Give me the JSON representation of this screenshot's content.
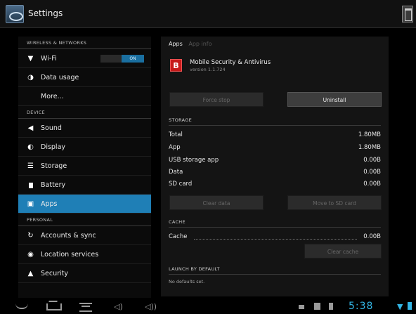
{
  "action_bar": {
    "title": "Settings"
  },
  "left_pane": {
    "sections": [
      {
        "header": "WIRELESS & NETWORKS",
        "items": [
          {
            "label": "Wi-Fi",
            "icon": "wifi-icon",
            "toggle": "ON"
          },
          {
            "label": "Data usage",
            "icon": "data-usage-icon"
          },
          {
            "label": "More..."
          }
        ]
      },
      {
        "header": "DEVICE",
        "items": [
          {
            "label": "Sound",
            "icon": "speaker-icon"
          },
          {
            "label": "Display",
            "icon": "display-icon"
          },
          {
            "label": "Storage",
            "icon": "storage-icon"
          },
          {
            "label": "Battery",
            "icon": "battery-icon"
          },
          {
            "label": "Apps",
            "icon": "apps-icon",
            "selected": true
          }
        ]
      },
      {
        "header": "PERSONAL",
        "items": [
          {
            "label": "Accounts & sync",
            "icon": "sync-icon"
          },
          {
            "label": "Location services",
            "icon": "location-icon"
          },
          {
            "label": "Security",
            "icon": "lock-icon"
          }
        ]
      }
    ]
  },
  "right_pane": {
    "breadcrumb": {
      "parent": "Apps",
      "current": "App info"
    },
    "app": {
      "name": "Mobile Security & Antivirus",
      "version": "version 1.1.724",
      "icon_letter": "B",
      "icon_color": "#c71a1a"
    },
    "buttons": {
      "force_stop": "Force stop",
      "uninstall": "Uninstall",
      "clear_data": "Clear data",
      "move_to_sd": "Move to SD card",
      "clear_cache": "Clear cache"
    },
    "storage": {
      "header": "STORAGE",
      "rows": [
        {
          "label": "Total",
          "value": "1.80MB"
        },
        {
          "label": "App",
          "value": "1.80MB"
        },
        {
          "label": "USB storage app",
          "value": "0.00B"
        },
        {
          "label": "Data",
          "value": "0.00B"
        },
        {
          "label": "SD card",
          "value": "0.00B"
        }
      ]
    },
    "cache": {
      "header": "CACHE",
      "label": "Cache",
      "value": "0.00B"
    },
    "launch": {
      "header": "LAUNCH BY DEFAULT",
      "note": "No defaults set."
    }
  },
  "system_bar": {
    "clock": "5:38",
    "accent": "#33b5e5"
  }
}
